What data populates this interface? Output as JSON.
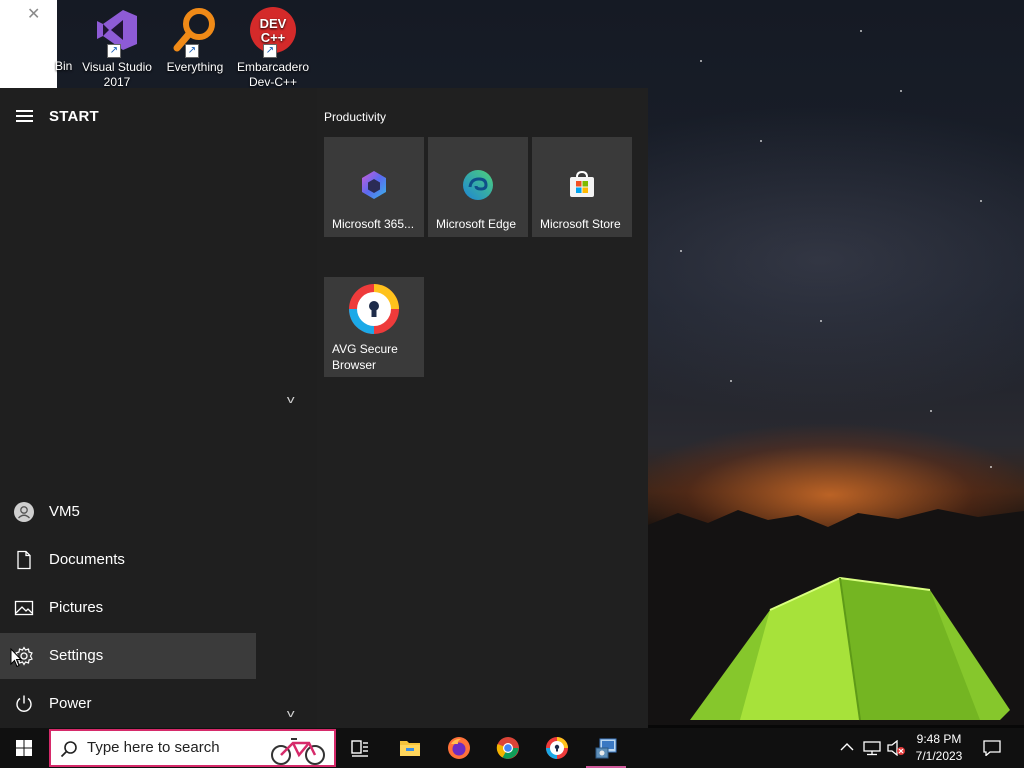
{
  "desktop": {
    "icons": [
      {
        "label_line1": "Visual Studio",
        "label_line2": "2017",
        "icon": "visual-studio-icon"
      },
      {
        "label_line1": "Everything",
        "label_line2": "",
        "icon": "everything-search-icon"
      },
      {
        "label_line1": "Embarcadero",
        "label_line2": "Dev-C++",
        "icon": "devcpp-icon",
        "badge": "DEV C++"
      }
    ],
    "partial_icon_label": "Bin"
  },
  "start_menu": {
    "title": "START",
    "nav": [
      {
        "label": "VM5",
        "icon": "user-avatar-icon"
      },
      {
        "label": "Documents",
        "icon": "document-icon"
      },
      {
        "label": "Pictures",
        "icon": "pictures-icon"
      },
      {
        "label": "Settings",
        "icon": "gear-icon",
        "active": true
      },
      {
        "label": "Power",
        "icon": "power-icon"
      }
    ],
    "group_title": "Productivity",
    "tiles": [
      {
        "label": "Microsoft 365...",
        "icon": "microsoft-365-icon"
      },
      {
        "label": "Microsoft Edge",
        "icon": "edge-icon"
      },
      {
        "label": "Microsoft Store",
        "icon": "store-icon"
      },
      {
        "label": "AVG Secure Browser",
        "icon": "avg-browser-icon"
      }
    ]
  },
  "taskbar": {
    "search_placeholder": "Type here to search",
    "apps": [
      "task-view-icon",
      "file-explorer-icon",
      "firefox-icon",
      "chrome-icon",
      "avg-browser-icon",
      "control-panel-icon"
    ],
    "clock": {
      "time": "9:48 PM",
      "date": "7/1/2023"
    }
  },
  "colors": {
    "accent": "#d62a6a",
    "menu_bg": "#202020",
    "tile_bg": "#3a3a3a"
  }
}
